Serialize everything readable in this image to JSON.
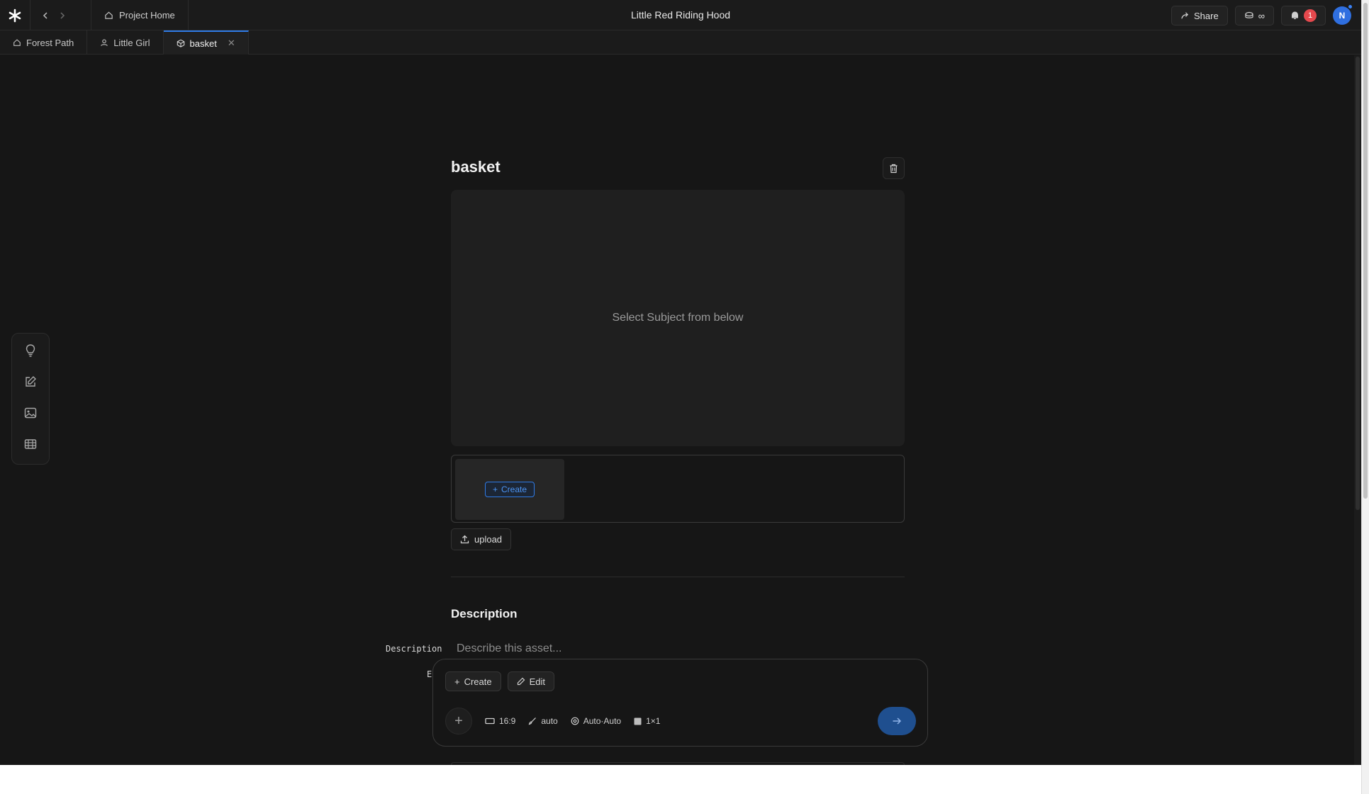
{
  "header": {
    "project_home_label": "Project Home",
    "title": "Little Red Riding Hood",
    "share_label": "Share",
    "credits_value": "∞",
    "notification_count": "1",
    "avatar_initial": "N"
  },
  "tabs": [
    {
      "label": "Forest Path",
      "icon": "home-icon"
    },
    {
      "label": "Little Girl",
      "icon": "user-icon"
    },
    {
      "label": "basket",
      "icon": "box-icon",
      "active": true
    }
  ],
  "tool_rail": [
    "lightbulb-icon",
    "edit-icon",
    "image-icon",
    "film-icon"
  ],
  "asset": {
    "title": "basket",
    "preview_placeholder": "Select Subject from below",
    "create_label": "Create",
    "upload_label": "upload"
  },
  "description": {
    "section_title": "Description",
    "field_label": "Description",
    "field_label_2_partial": "E",
    "placeholder": "Describe this asset..."
  },
  "composer": {
    "create_label": "Create",
    "edit_label": "Edit",
    "aspect_ratio": "16:9",
    "style": "auto",
    "model": "Auto·Auto",
    "grid": "1×1"
  },
  "colors": {
    "accent": "#2f7be6",
    "badge": "#e5484d",
    "background": "#161616"
  }
}
